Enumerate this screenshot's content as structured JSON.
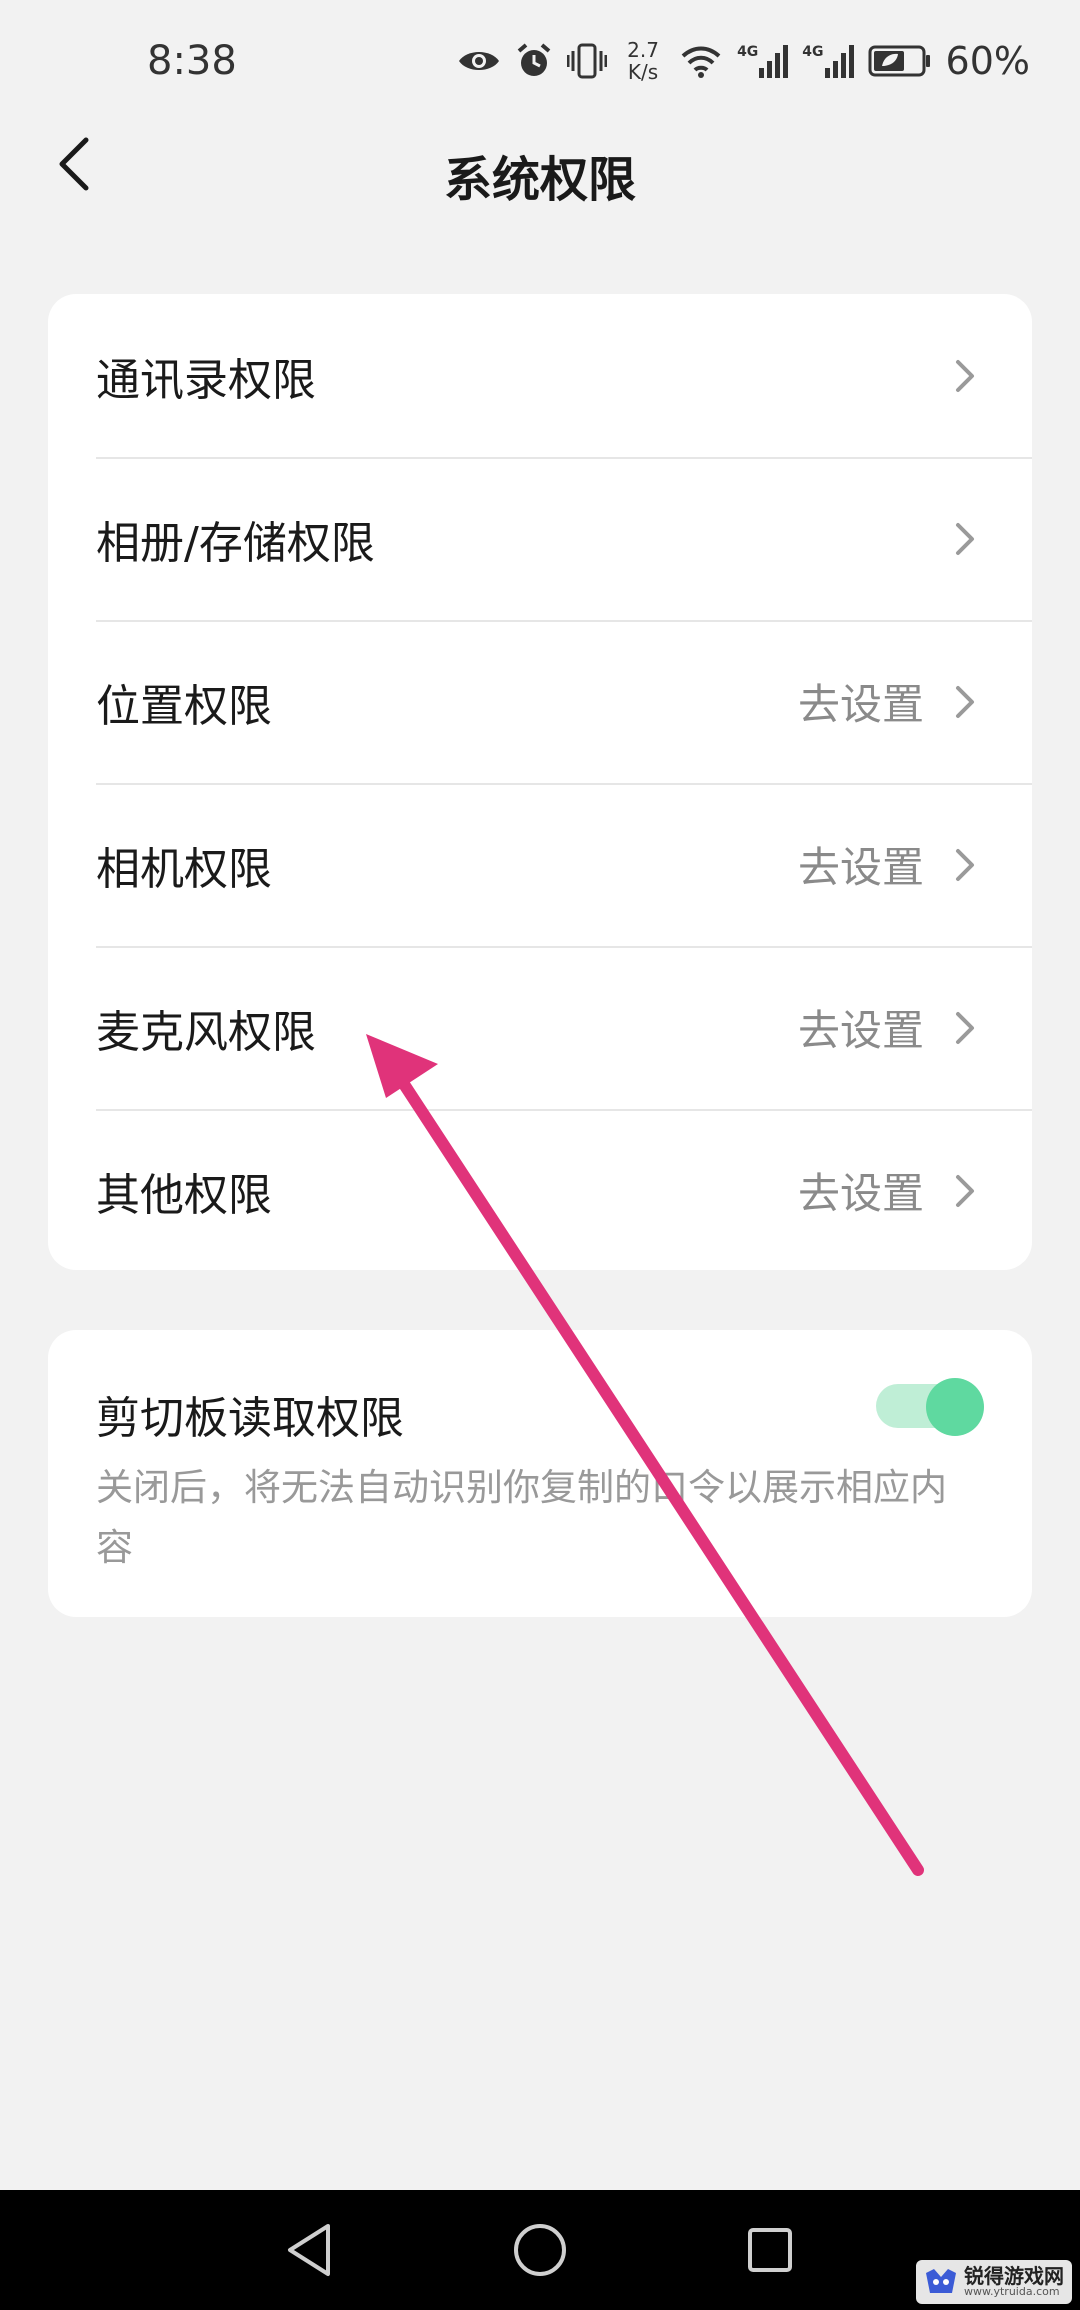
{
  "status_bar": {
    "time": "8:38",
    "net_speed_value": "2.7",
    "net_speed_unit": "K/s",
    "signal_1_label": "4G",
    "signal_2_label": "4G",
    "battery_percent": "60%",
    "icons": [
      "eye-icon",
      "alarm-icon",
      "vibrate-icon",
      "wifi-icon",
      "signal-icon",
      "battery-icon"
    ]
  },
  "header": {
    "title": "系统权限",
    "back_icon": "back-chevron-icon"
  },
  "permissions": {
    "items": [
      {
        "label": "通讯录权限",
        "action": ""
      },
      {
        "label": "相册/存储权限",
        "action": ""
      },
      {
        "label": "位置权限",
        "action": "去设置"
      },
      {
        "label": "相机权限",
        "action": "去设置"
      },
      {
        "label": "麦克风权限",
        "action": "去设置"
      },
      {
        "label": "其他权限",
        "action": "去设置"
      }
    ]
  },
  "clipboard": {
    "title": "剪切板读取权限",
    "description": "关闭后，将无法自动识别你复制的口令以展示相应内容",
    "enabled": true
  },
  "colors": {
    "background": "#f2f2f2",
    "card": "#ffffff",
    "toggle_on": "#5fd9a0",
    "annotation_arrow": "#e0337a"
  },
  "watermark": {
    "title": "锐得游戏网",
    "url": "www.ytruida.com"
  }
}
